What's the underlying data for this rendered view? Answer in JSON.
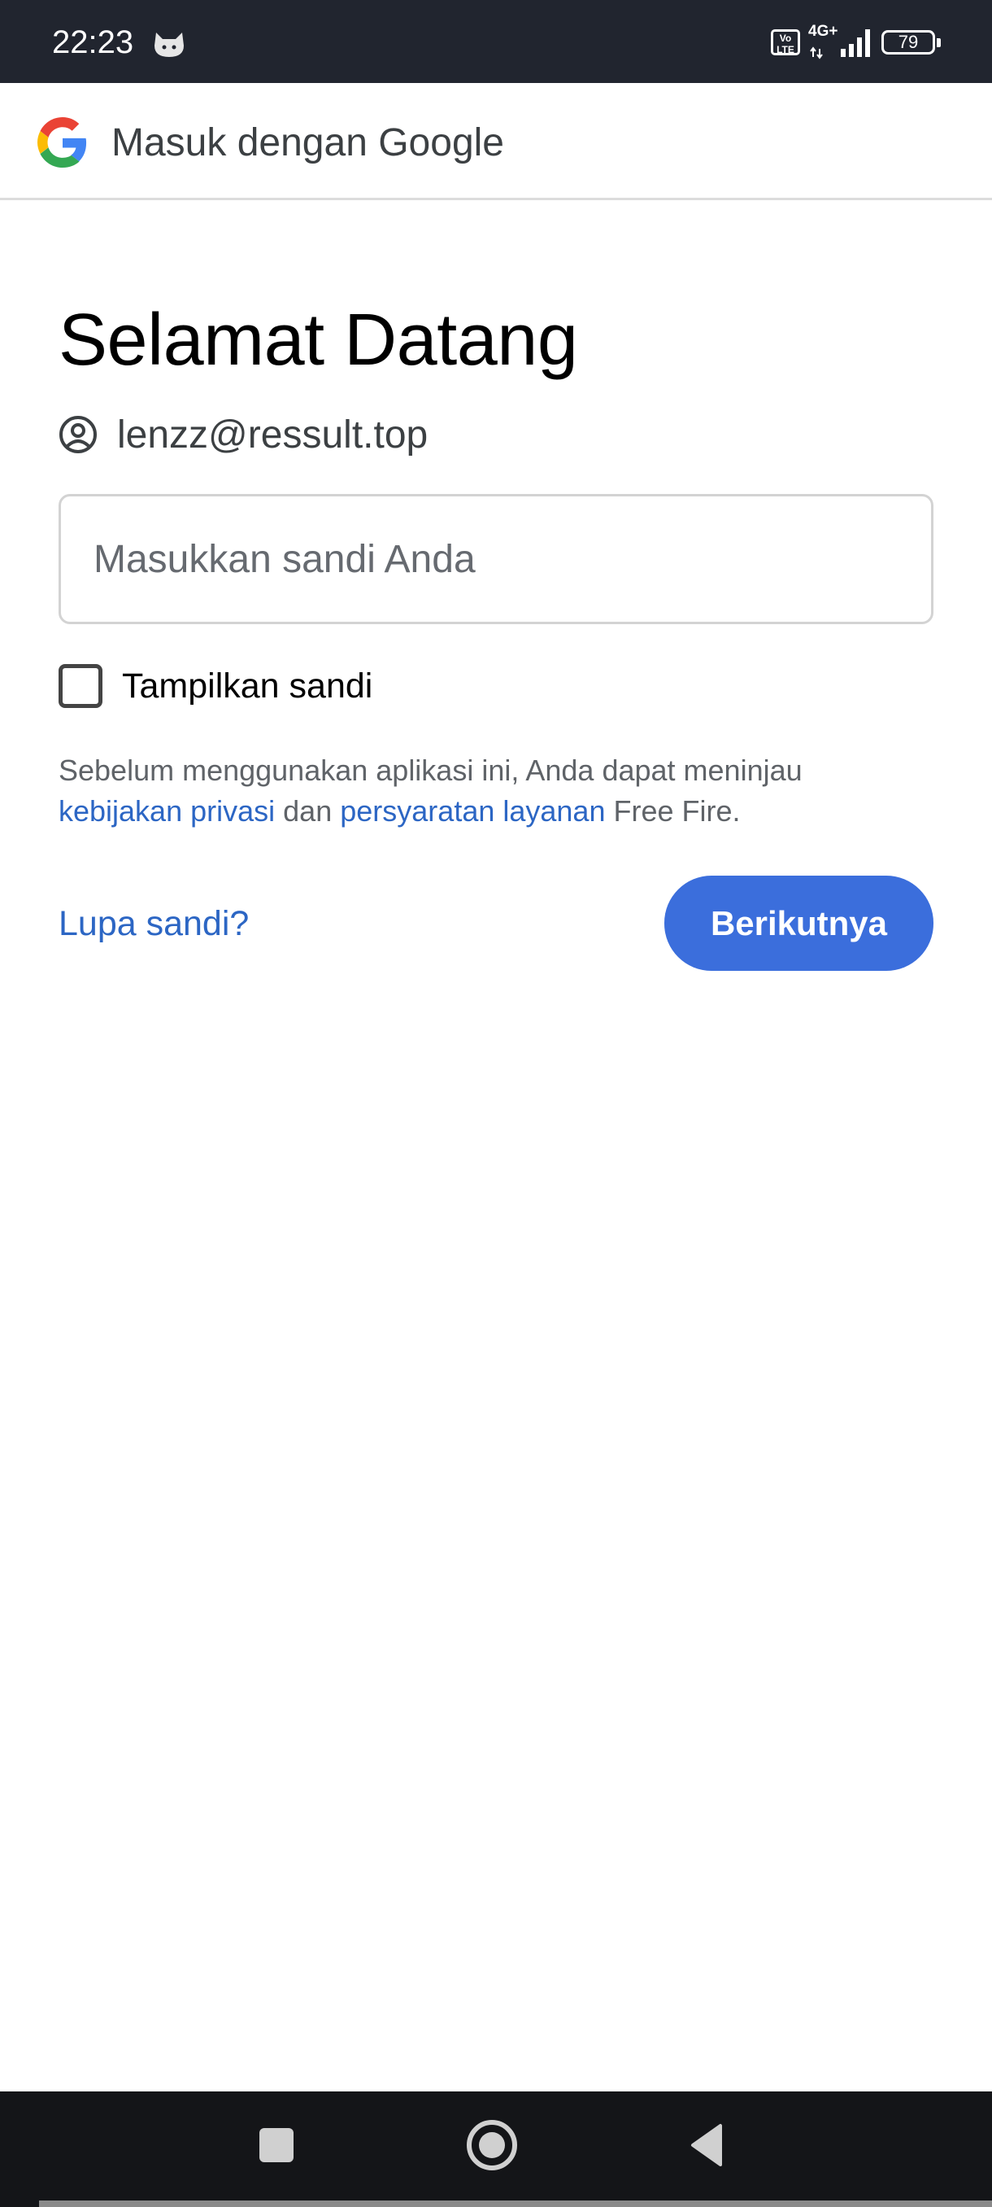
{
  "status_bar": {
    "time": "22:23",
    "volte_label": "Vo LTE",
    "network": "4G+",
    "battery": "79"
  },
  "header": {
    "title": "Masuk dengan Google",
    "logo_icon": "google-g-icon"
  },
  "main": {
    "welcome": "Selamat Datang",
    "account_email": "lenzz@ressult.top",
    "password_placeholder": "Masukkan sandi Anda",
    "show_password_label": "Tampilkan sandi",
    "disclaimer": {
      "before": "Sebelum menggunakan aplikasi ini, Anda dapat meninjau",
      "privacy_link": "kebijakan privasi",
      "middle": "dan",
      "terms_link": "persyaratan layanan",
      "after": "Free Fire."
    },
    "forgot_password": "Lupa sandi?",
    "next_button": "Berikutnya"
  },
  "colors": {
    "status_bar_bg": "#21252f",
    "accent_blue": "#3b6edc",
    "link_blue": "#2c66c4",
    "nav_bar_bg": "#141518"
  }
}
